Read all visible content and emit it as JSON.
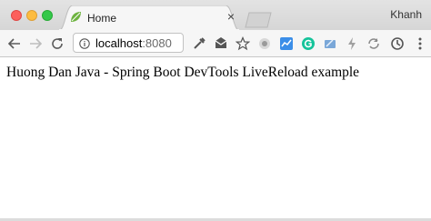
{
  "window": {
    "traffic_lights": {
      "close": "#fc605c",
      "minimize": "#fdbc40",
      "maximize": "#34c84a"
    },
    "profile_name": "Khanh"
  },
  "tab": {
    "title": "Home",
    "favicon": "spring-leaf-icon",
    "close_glyph": "×"
  },
  "toolbar": {
    "back_icon": "back-arrow-icon",
    "forward_icon": "forward-arrow-icon",
    "reload_icon": "reload-icon",
    "address": {
      "host": "localhost",
      "port": ":8080",
      "info_icon": "info-icon"
    },
    "extensions": [
      "eyedropper-icon",
      "mail-icon",
      "star-icon",
      "circle-icon",
      "chart-icon",
      "grammarly-icon",
      "pencil-icon",
      "lightning-icon",
      "sync-icon",
      "history-icon",
      "menu-icon"
    ]
  },
  "page": {
    "text": "Huong Dan Java - Spring Boot DevTools LiveReload example"
  }
}
